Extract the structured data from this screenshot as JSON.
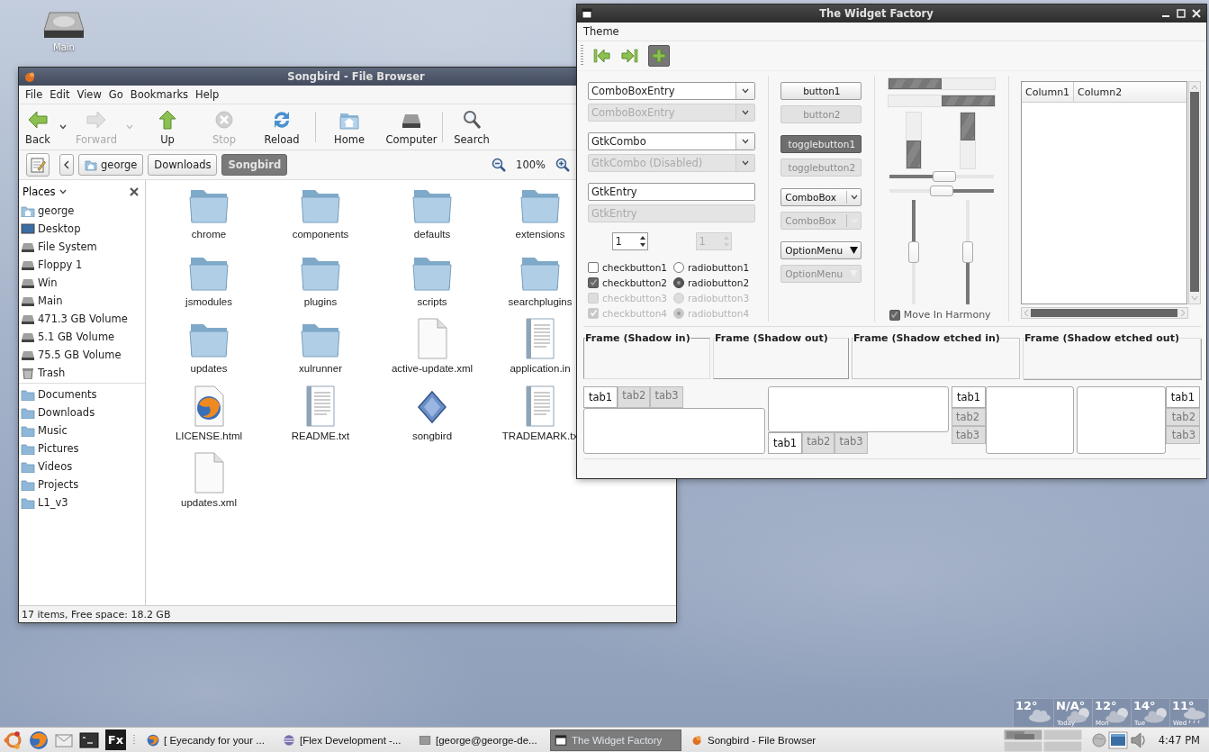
{
  "desktop": {
    "icons": [
      {
        "label": "Main"
      }
    ]
  },
  "file_browser": {
    "title": "Songbird - File Browser",
    "menu": [
      "File",
      "Edit",
      "View",
      "Go",
      "Bookmarks",
      "Help"
    ],
    "toolbar": [
      {
        "kind": "back",
        "label": "Back",
        "disabled": false,
        "dropdown": true
      },
      {
        "kind": "forward",
        "label": "Forward",
        "disabled": true,
        "dropdown": true
      },
      {
        "kind": "up",
        "label": "Up",
        "disabled": false
      },
      {
        "kind": "stop",
        "label": "Stop",
        "disabled": true
      },
      {
        "kind": "reload",
        "label": "Reload",
        "disabled": false
      },
      {
        "kind": "home",
        "label": "Home",
        "disabled": false,
        "separator_before": true
      },
      {
        "kind": "computer",
        "label": "Computer",
        "disabled": false
      },
      {
        "kind": "search",
        "label": "Search",
        "disabled": false,
        "separator_before": true
      }
    ],
    "path": [
      {
        "label": "george",
        "kind": "home",
        "selected": false
      },
      {
        "label": "Downloads",
        "selected": false
      },
      {
        "label": "Songbird",
        "selected": true
      }
    ],
    "zoom": "100%",
    "sidebar": {
      "title": "Places",
      "groups": [
        [
          {
            "label": "george",
            "kind": "home"
          },
          {
            "label": "Desktop",
            "kind": "desktop"
          },
          {
            "label": "File System",
            "kind": "drive"
          },
          {
            "label": "Floppy 1",
            "kind": "drive"
          },
          {
            "label": "Win",
            "kind": "drive"
          },
          {
            "label": "Main",
            "kind": "drive"
          },
          {
            "label": "471.3 GB Volume",
            "kind": "drive"
          },
          {
            "label": "5.1 GB Volume",
            "kind": "drive"
          },
          {
            "label": "75.5 GB Volume",
            "kind": "drive"
          },
          {
            "label": "Trash",
            "kind": "trash"
          }
        ],
        [
          {
            "label": "Documents",
            "kind": "folder"
          },
          {
            "label": "Downloads",
            "kind": "folder"
          },
          {
            "label": "Music",
            "kind": "folder"
          },
          {
            "label": "Pictures",
            "kind": "folder"
          },
          {
            "label": "Videos",
            "kind": "folder"
          },
          {
            "label": "Projects",
            "kind": "folder"
          },
          {
            "label": "L1_v3",
            "kind": "folder"
          }
        ]
      ]
    },
    "items": [
      {
        "label": "chrome",
        "kind": "folder"
      },
      {
        "label": "components",
        "kind": "folder"
      },
      {
        "label": "defaults",
        "kind": "folder"
      },
      {
        "label": "extensions",
        "kind": "folder"
      },
      {
        "label": "jsmodules",
        "kind": "folder"
      },
      {
        "label": "plugins",
        "kind": "folder"
      },
      {
        "label": "scripts",
        "kind": "folder"
      },
      {
        "label": "searchplugins",
        "kind": "folder"
      },
      {
        "label": "updates",
        "kind": "folder"
      },
      {
        "label": "xulrunner",
        "kind": "folder"
      },
      {
        "label": "active-update.xml",
        "kind": "file"
      },
      {
        "label": "application.in",
        "kind": "document"
      },
      {
        "label": "LICENSE.html",
        "kind": "web"
      },
      {
        "label": "README.txt",
        "kind": "document"
      },
      {
        "label": "songbird",
        "kind": "app"
      },
      {
        "label": "TRADEMARK.tx",
        "kind": "document"
      },
      {
        "label": "updates.xml",
        "kind": "file"
      }
    ],
    "status": "17 items, Free space: 18.2 GB"
  },
  "widget_factory": {
    "title": "The Widget Factory",
    "menu": [
      "Theme"
    ],
    "toolbar": [
      {
        "kind": "first",
        "on": false
      },
      {
        "kind": "last",
        "on": false
      },
      {
        "kind": "add",
        "on": true
      }
    ],
    "fields": [
      {
        "kind": "combo",
        "text": "ComboBoxEntry",
        "disabled": false
      },
      {
        "kind": "combo",
        "text": "ComboBoxEntry",
        "disabled": true
      },
      {
        "kind": "combo",
        "text": "GtkCombo",
        "disabled": false
      },
      {
        "kind": "combo",
        "text": "GtkCombo (Disabled)",
        "disabled": true
      },
      {
        "kind": "entry",
        "text": "GtkEntry",
        "disabled": false
      },
      {
        "kind": "entry",
        "text": "GtkEntry",
        "disabled": true
      }
    ],
    "spins": [
      {
        "value": "1",
        "disabled": false
      },
      {
        "value": "1",
        "disabled": true
      }
    ],
    "checks": [
      {
        "label": "checkbutton1",
        "checked": false,
        "disabled": false
      },
      {
        "label": "checkbutton2",
        "checked": true,
        "disabled": false
      },
      {
        "label": "checkbutton3",
        "checked": false,
        "disabled": true
      },
      {
        "label": "checkbutton4",
        "checked": true,
        "disabled": true
      }
    ],
    "radios": [
      {
        "label": "radiobutton1",
        "selected": false,
        "disabled": false
      },
      {
        "label": "radiobutton2",
        "selected": true,
        "disabled": false
      },
      {
        "label": "radiobutton3",
        "selected": false,
        "disabled": true
      },
      {
        "label": "radiobutton4",
        "selected": true,
        "disabled": true
      }
    ],
    "buttons": [
      {
        "kind": "button",
        "label": "button1",
        "disabled": false
      },
      {
        "kind": "button",
        "label": "button2",
        "disabled": true
      },
      {
        "kind": "toggle",
        "label": "togglebutton1",
        "on": true,
        "disabled": false
      },
      {
        "kind": "toggle",
        "label": "togglebutton2",
        "on": false,
        "disabled": true
      },
      {
        "kind": "combobox",
        "label": "ComboBox",
        "disabled": false
      },
      {
        "kind": "combobox",
        "label": "ComboBox",
        "disabled": true
      },
      {
        "kind": "optionmenu",
        "label": "OptionMenu",
        "disabled": false
      },
      {
        "kind": "optionmenu",
        "label": "OptionMenu",
        "disabled": true
      }
    ],
    "progress_horizontal": [
      {
        "inverted": false,
        "level": 0.5
      },
      {
        "inverted": true,
        "level": 0.5
      }
    ],
    "progress_vertical": [
      {
        "inverted": false,
        "level": 0.5
      },
      {
        "inverted": true,
        "level": 0.5
      }
    ],
    "scales_horizontal": [
      {
        "inverted": false,
        "level": 0.53
      },
      {
        "inverted": true,
        "level": 0.5
      }
    ],
    "scales_vertical": [
      {
        "inverted": true,
        "level": 0.5
      },
      {
        "inverted": false,
        "level": 0.5
      }
    ],
    "harmony": {
      "label": "Move In Harmony",
      "checked": true
    },
    "tree": {
      "columns": [
        "Column1",
        "Column2"
      ]
    },
    "frames": [
      {
        "kind": "in",
        "label": "Frame (Shadow in)"
      },
      {
        "kind": "out",
        "label": "Frame (Shadow out)"
      },
      {
        "kind": "etched_in",
        "label": "Frame (Shadow etched in)"
      },
      {
        "kind": "etched_out",
        "label": "Frame (Shadow etched out)"
      }
    ],
    "notebooks": [
      {
        "kind": "top",
        "tabs": [
          {
            "label": "tab1",
            "selected": true
          },
          {
            "label": "tab2",
            "selected": false
          },
          {
            "label": "tab3",
            "selected": false
          }
        ]
      },
      {
        "kind": "bottom",
        "tabs": [
          {
            "label": "tab1",
            "selected": true
          },
          {
            "label": "tab2",
            "selected": false
          },
          {
            "label": "tab3",
            "selected": false
          }
        ]
      },
      {
        "kind": "left",
        "tabs": [
          {
            "label": "tab1",
            "selected": true
          },
          {
            "label": "tab2",
            "selected": false
          },
          {
            "label": "tab3",
            "selected": false
          }
        ]
      },
      {
        "kind": "right",
        "tabs": [
          {
            "label": "tab1",
            "selected": true
          },
          {
            "label": "tab2",
            "selected": false
          },
          {
            "label": "tab3",
            "selected": false
          }
        ]
      }
    ]
  },
  "weather": [
    {
      "temp": "12°",
      "kind": "cloud"
    },
    {
      "temp": "N/A°",
      "day": "Today",
      "kind": "sun_cloud"
    },
    {
      "temp": "12°",
      "day": "Mon",
      "kind": "sun_cloud"
    },
    {
      "temp": "14°",
      "day": "Tue",
      "kind": "sun_cloud"
    },
    {
      "temp": "11°",
      "day": "Wed",
      "kind": "rain"
    }
  ],
  "taskbar": {
    "launchers": [
      {
        "kind": "logo"
      },
      {
        "kind": "browser"
      },
      {
        "kind": "mail"
      },
      {
        "kind": "terminal"
      },
      {
        "kind": "text",
        "label": "Fx"
      }
    ],
    "tasks": [
      {
        "label": "[ Eyecandy for your ...",
        "kind": "browser",
        "selected": false
      },
      {
        "label": "[Flex Development -...",
        "kind": "sphere",
        "selected": false
      },
      {
        "label": "[george@george-de...",
        "kind": "terminal",
        "selected": false
      },
      {
        "label": "The Widget Factory",
        "kind": "window",
        "selected": true
      },
      {
        "label": "Songbird - File Browser",
        "kind": "bird",
        "selected": false
      }
    ],
    "clock": "4:47 PM"
  }
}
